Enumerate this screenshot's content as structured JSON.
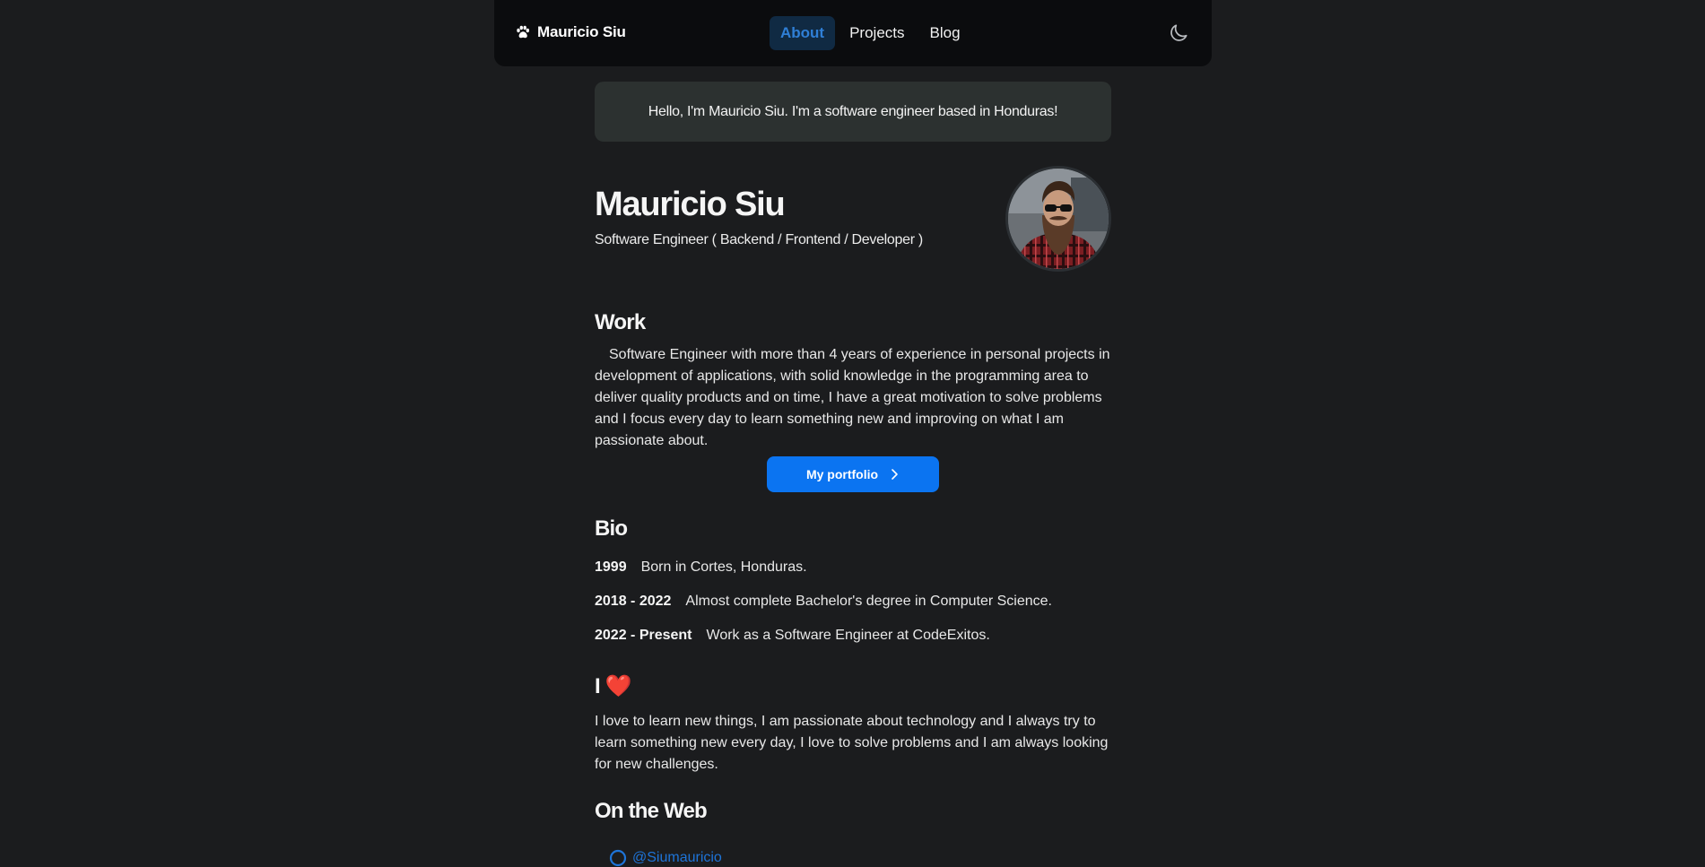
{
  "navbar": {
    "brand": "Mauricio Siu",
    "brand_icon": "paw-icon",
    "links": [
      {
        "label": "About",
        "active": true
      },
      {
        "label": "Projects",
        "active": false
      },
      {
        "label": "Blog",
        "active": false
      }
    ],
    "theme_icon": "moon-icon"
  },
  "hello": "Hello, I'm Mauricio Siu. I'm a software engineer based in Honduras!",
  "profile": {
    "name": "Mauricio Siu",
    "title": "Software Engineer ( Backend / Frontend / Developer )"
  },
  "work": {
    "heading": "Work",
    "text": "Software Engineer with more than 4 years of experience in personal projects in development of applications, with solid knowledge in the programming area to deliver quality products and on time, I have a great motivation to solve problems and I focus every day to learn something new and improving on what I am passionate about.",
    "button": "My portfolio"
  },
  "bio": {
    "heading": "Bio",
    "items": [
      {
        "year": "1999",
        "text": "Born in Cortes, Honduras."
      },
      {
        "year": "2018 - 2022",
        "text": "Almost complete Bachelor's degree in Computer Science."
      },
      {
        "year": "2022 - Present",
        "text": "Work as a Software Engineer at CodeExitos."
      }
    ]
  },
  "love": {
    "heading": "I ❤️",
    "text": "I love to learn new things, I am passionate about technology and I always try to learn something new every day, I love to solve problems and I am always looking for new challenges."
  },
  "web": {
    "heading": "On the Web",
    "link": "@Siumauricio"
  },
  "colors": {
    "background": "#1b1c1e",
    "accent": "#0b74f1",
    "active_link": "#2f7fd6"
  }
}
